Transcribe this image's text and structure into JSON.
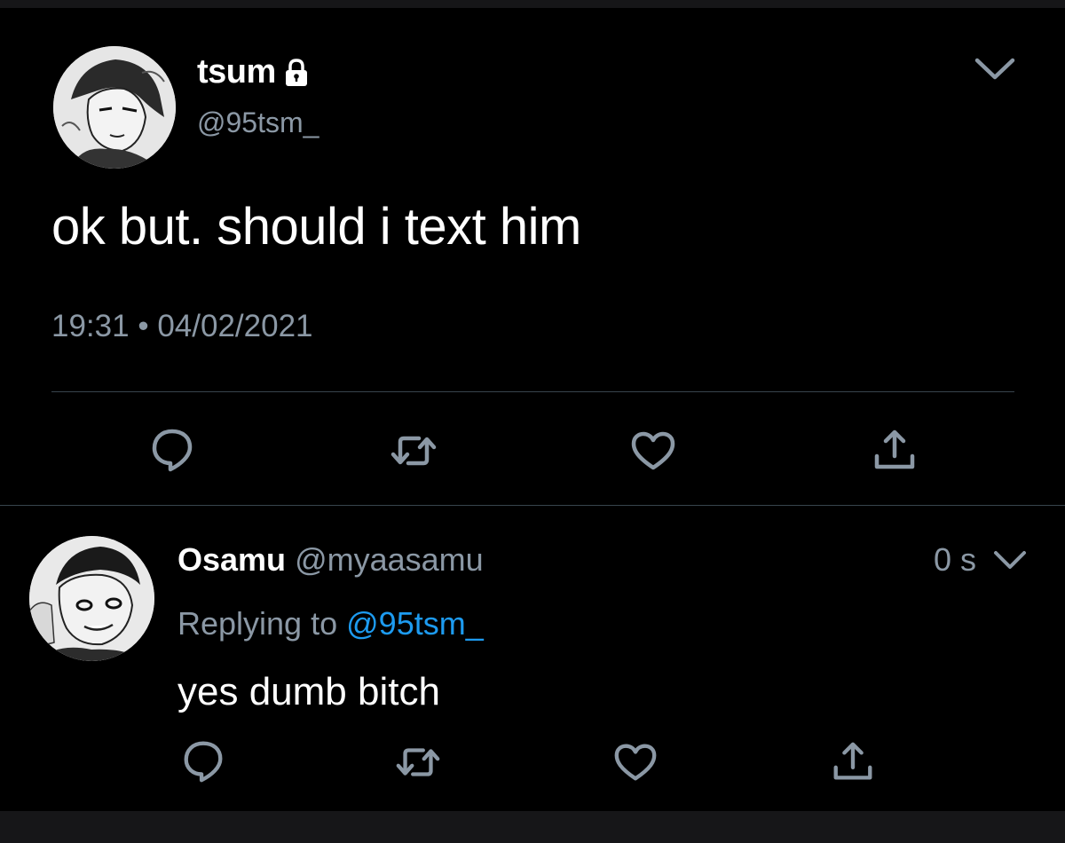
{
  "tweet": {
    "display_name": "tsum",
    "handle": "@95tsm_",
    "text": "ok but. should i text him",
    "time": "19:31",
    "separator": "•",
    "date": "04/02/2021",
    "icons": [
      "lock-icon",
      "chevron-down-icon",
      "reply-icon",
      "retweet-icon",
      "like-icon",
      "share-icon"
    ]
  },
  "reply": {
    "display_name": "Osamu",
    "handle": "@myaasamu",
    "time": "0 s",
    "replying_prefix": "Replying to",
    "replying_handle": "@95tsm_",
    "text": "yes dumb bitch",
    "icons": [
      "chevron-down-icon",
      "reply-icon",
      "retweet-icon",
      "like-icon",
      "share-icon"
    ]
  },
  "colors": {
    "background": "#000000",
    "secondary_text": "#8b98a5",
    "link": "#1d9bf0",
    "divider": "#38444d"
  }
}
